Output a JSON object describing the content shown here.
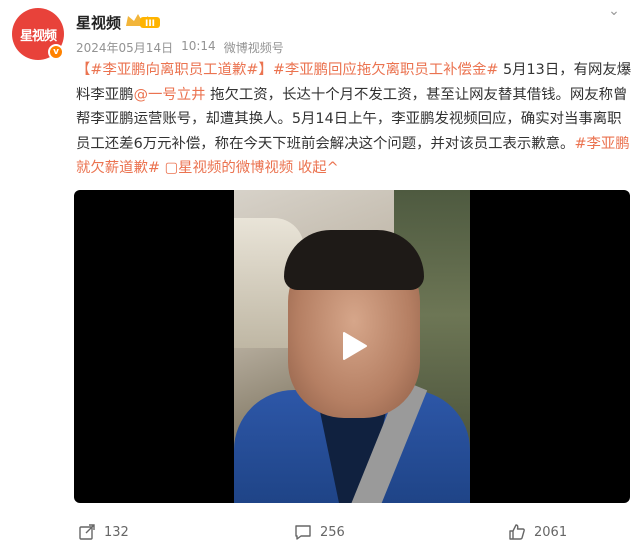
{
  "header": {
    "author": "星视频",
    "avatar_text": "星视频",
    "level_badge": "III",
    "timestamp": "2024年05月14日",
    "time": "10:14",
    "source": "微博视频号"
  },
  "content": {
    "topic1": "【#李亚鹏向离职员工道歉#】",
    "topic2": "#李亚鹏回应拖欠离职员工补偿金#",
    "text1": " 5月13日，有网友爆料李亚鹏",
    "mention": "@一号立井",
    "text2": " 拖欠工资，长达十个月不发工资，甚至让网友替其借钱。网友称曾帮李亚鹏运营账号，却遭其换人。5月14日上午，李亚鹏发视频回应，确实对当事离职员工还差6万元补偿，称在今天下班前会解决这个问题，并对该员工表示歉意。",
    "topic3": "#李亚鹏就欠薪道歉#",
    "video_link": " ▢星视频的微博视频",
    "collapse": " 收起^"
  },
  "actions": {
    "share_count": "132",
    "comment_count": "256",
    "like_count": "2061"
  },
  "colors": {
    "accent": "#eb7350",
    "brand_red": "#e8423a",
    "verify": "#ff8200"
  }
}
